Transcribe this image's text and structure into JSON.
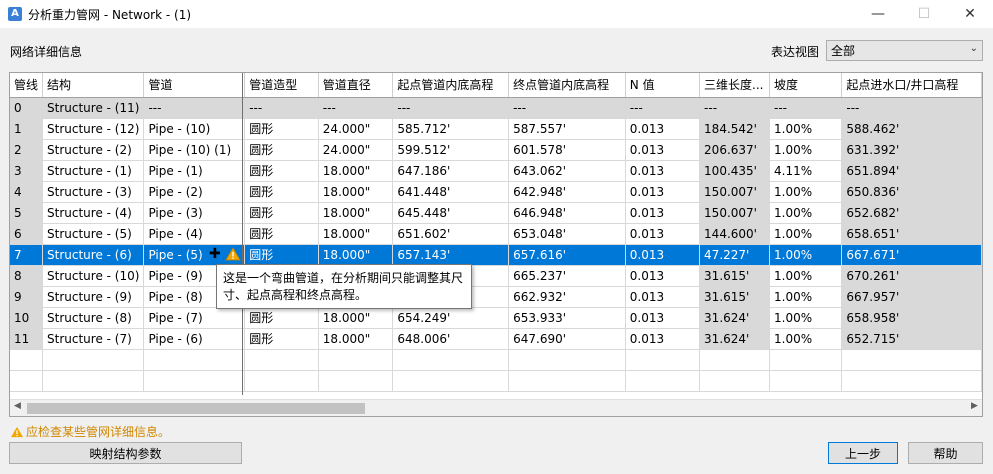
{
  "window": {
    "title": "分析重力管网 - Network - (1)",
    "app_icon_letter": "A",
    "minimize": "—",
    "maximize": "☐",
    "close": "✕"
  },
  "section_label": "网络详细信息",
  "view": {
    "label": "表达视图",
    "value": "全部"
  },
  "columns": [
    "管线",
    "结构",
    "管道",
    "管道造型",
    "管道直径",
    "起点管道内底高程",
    "终点管道内底高程",
    "N 值",
    "三维长度...",
    "坡度",
    "起点进水口/井口高程"
  ],
  "rows": [
    [
      "0",
      "Structure - (11)",
      "---",
      "---",
      "---",
      "---",
      "---",
      "---",
      "---",
      "---",
      "---"
    ],
    [
      "1",
      "Structure - (12)",
      "Pipe - (10)",
      "圆形",
      "24.000\"",
      "585.712'",
      "587.557'",
      "0.013",
      "184.542'",
      "1.00%",
      "588.462'"
    ],
    [
      "2",
      "Structure - (2)",
      "Pipe - (10) (1)",
      "圆形",
      "24.000\"",
      "599.512'",
      "601.578'",
      "0.013",
      "206.637'",
      "1.00%",
      "631.392'"
    ],
    [
      "3",
      "Structure - (1)",
      "Pipe - (1)",
      "圆形",
      "18.000\"",
      "647.186'",
      "643.062'",
      "0.013",
      "100.435'",
      "4.11%",
      "651.894'"
    ],
    [
      "4",
      "Structure - (3)",
      "Pipe - (2)",
      "圆形",
      "18.000\"",
      "641.448'",
      "642.948'",
      "0.013",
      "150.007'",
      "1.00%",
      "650.836'"
    ],
    [
      "5",
      "Structure - (4)",
      "Pipe - (3)",
      "圆形",
      "18.000\"",
      "645.448'",
      "646.948'",
      "0.013",
      "150.007'",
      "1.00%",
      "652.682'"
    ],
    [
      "6",
      "Structure - (5)",
      "Pipe - (4)",
      "圆形",
      "18.000\"",
      "651.602'",
      "653.048'",
      "0.013",
      "144.600'",
      "1.00%",
      "658.651'"
    ],
    [
      "7",
      "Structure - (6)",
      "Pipe - (5)",
      "圆形",
      "18.000\"",
      "657.143'",
      "657.616'",
      "0.013",
      "47.227'",
      "1.00%",
      "667.671'"
    ],
    [
      "8",
      "Structure - (10)",
      "Pipe - (9)",
      "",
      "",
      "",
      "665.237'",
      "0.013",
      "31.615'",
      "1.00%",
      "670.261'"
    ],
    [
      "9",
      "Structure - (9)",
      "Pipe - (8)",
      "",
      "",
      "",
      "662.932'",
      "0.013",
      "31.615'",
      "1.00%",
      "667.957'"
    ],
    [
      "10",
      "Structure - (8)",
      "Pipe - (7)",
      "圆形",
      "18.000\"",
      "654.249'",
      "653.933'",
      "0.013",
      "31.624'",
      "1.00%",
      "658.958'"
    ],
    [
      "11",
      "Structure - (7)",
      "Pipe - (6)",
      "圆形",
      "18.000\"",
      "648.006'",
      "647.690'",
      "0.013",
      "31.624'",
      "1.00%",
      "652.715'"
    ]
  ],
  "selected_row": 7,
  "tooltip": "这是一个弯曲管道，在分析期间只能调整其尺寸、起点高程和终点高程。",
  "warning": "应检查某些管网详细信息。",
  "buttons": {
    "map": "映射结构参数",
    "back": "上一步",
    "help": "帮助"
  },
  "colors": {
    "selection": "#0078d7",
    "warning": "#e8a000",
    "readonly_cell": "#d9d9d9"
  }
}
